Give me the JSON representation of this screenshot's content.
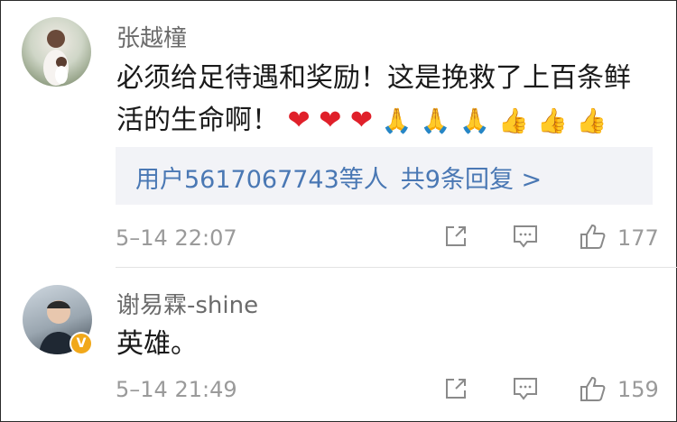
{
  "comments": [
    {
      "username": "张越橦",
      "text_line1": "必须给足待遇和奖励！这是挽救了上百条鲜",
      "text_line2": "活的生命啊！",
      "emojis": {
        "hearts": [
          "❤",
          "❤",
          "❤"
        ],
        "prays": [
          "🙏",
          "🙏",
          "🙏"
        ],
        "thumbs": [
          "👍",
          "👍",
          "👍"
        ]
      },
      "replies": {
        "users": "用户5617067743等人",
        "total": "共9条回复 >"
      },
      "timestamp": "5–14 22:07",
      "like_count": "177",
      "avatar_icon": "portrait-avatar"
    },
    {
      "username": "谢易霖-shine",
      "text": "英雄。",
      "timestamp": "5–14 21:49",
      "like_count": "159",
      "avatar_icon": "portrait-avatar",
      "verified_badge": "V"
    }
  ],
  "icons": {
    "share": "share-icon",
    "comment": "comment-icon",
    "like": "thumbs-up-icon"
  },
  "colors": {
    "link": "#4a78b4",
    "meta": "#9a9a9a",
    "reply_bg": "#f2f3f7",
    "verified": "#f1a81a"
  }
}
